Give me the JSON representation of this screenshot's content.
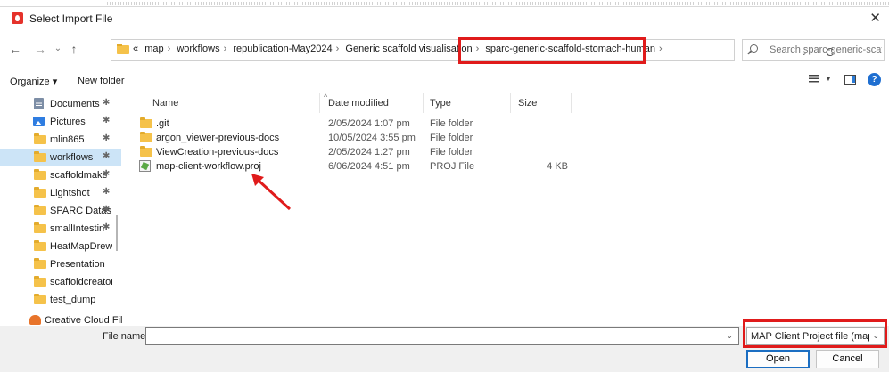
{
  "window": {
    "title": "Select Import File",
    "close": "✕"
  },
  "nav": {
    "back": "←",
    "forward": "→",
    "recent": "⌄",
    "up": "↑",
    "refresh": "C",
    "dropdown": "⌄"
  },
  "address": {
    "overflow": "«",
    "crumbs": [
      "map",
      "workflows",
      "republication-May2024",
      "Generic scaffold visualisation",
      "sparc-generic-scaffold-stomach-human"
    ],
    "separator": "›"
  },
  "search": {
    "placeholder": "Search sparc-generic-scaffol..."
  },
  "toolbar": {
    "organize": "Organize ▾",
    "new_folder": "New folder",
    "help": "?"
  },
  "sidebar": {
    "items": [
      {
        "label": "Documents",
        "icon": "document-icon",
        "pinned": true
      },
      {
        "label": "Pictures",
        "icon": "pictures-icon",
        "pinned": true
      },
      {
        "label": "mlin865",
        "icon": "folder-icon",
        "pinned": true
      },
      {
        "label": "workflows",
        "icon": "folder-icon",
        "pinned": true,
        "selected": true
      },
      {
        "label": "scaffoldmake",
        "icon": "folder-icon",
        "pinned": true
      },
      {
        "label": "Lightshot",
        "icon": "folder-icon",
        "pinned": true
      },
      {
        "label": "SPARC Datas",
        "icon": "folder-icon",
        "pinned": true
      },
      {
        "label": "smallIntestin",
        "icon": "folder-icon",
        "pinned": true
      },
      {
        "label": "HeatMapDrew-(",
        "icon": "folder-icon",
        "pinned": false
      },
      {
        "label": "Presentation",
        "icon": "folder-icon",
        "pinned": false
      },
      {
        "label": "scaffoldcreator",
        "icon": "folder-icon",
        "pinned": false
      },
      {
        "label": "test_dump",
        "icon": "folder-icon",
        "pinned": false
      },
      {
        "label": "Creative Cloud Fil",
        "icon": "creative-cloud-icon",
        "pinned": false
      }
    ],
    "pin_glyph": "✱"
  },
  "columns": {
    "name": "Name",
    "date": "Date modified",
    "type": "Type",
    "size": "Size"
  },
  "files": [
    {
      "name": ".git",
      "date": "2/05/2024 1:07 pm",
      "type": "File folder",
      "size": "",
      "icon": "folder-icon"
    },
    {
      "name": "argon_viewer-previous-docs",
      "date": "10/05/2024 3:55 pm",
      "type": "File folder",
      "size": "",
      "icon": "folder-icon"
    },
    {
      "name": "ViewCreation-previous-docs",
      "date": "2/05/2024 1:27 pm",
      "type": "File folder",
      "size": "",
      "icon": "folder-icon"
    },
    {
      "name": "map-client-workflow.proj",
      "date": "6/06/2024 4:51 pm",
      "type": "PROJ File",
      "size": "4 KB",
      "icon": "proj-file-icon"
    }
  ],
  "footer": {
    "file_name_label": "File name:",
    "file_name_value": "",
    "file_type": "MAP Client Project file (map-cl",
    "open": "Open",
    "cancel": "Cancel"
  },
  "colors": {
    "highlight": "#e01b1b",
    "selection": "#cce4f7",
    "folder": "#f5c24a",
    "accent": "#1b6ec2"
  }
}
